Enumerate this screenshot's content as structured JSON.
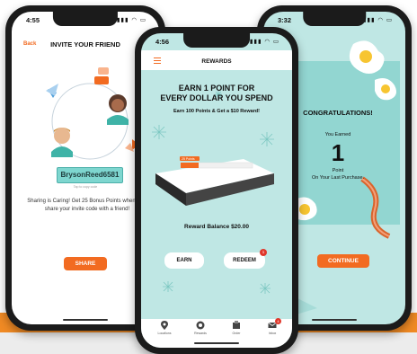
{
  "colors": {
    "accent": "#f26b21",
    "teal": "#92d6d1",
    "band": "#f08a24"
  },
  "left_screen": {
    "time": "4:55",
    "status_icons": "▮▮▮ ◠ ▭",
    "back_label": "Back",
    "title": "INVITE YOUR FRIEND",
    "invite_code": "BrysonReed6581",
    "tap_hint": "Tap to copy code",
    "share_text": "Sharing is Caring! Get 25 Bonus Points when they share your invite code with a friend!",
    "share_button": "SHARE"
  },
  "center_screen": {
    "time": "4:56",
    "status_icons": "▮▮▮ ◠ ▭",
    "menu_icon": "hamburger-icon",
    "title": "REWARDS",
    "headline_1": "EARN 1 POINT FOR",
    "headline_2": "EVERY DOLLAR YOU SPEND",
    "subline": "Earn 100 Points & Get a $10 Reward!",
    "progress_label": "25 Points",
    "progress_value": 25,
    "progress_goal": 100,
    "balance": "Reward Balance $20.00",
    "earn_button": "EARN",
    "redeem_button": "REDEEM",
    "redeem_badge": "1",
    "tabs": [
      {
        "label": "Locations",
        "icon": "location-pin-icon"
      },
      {
        "label": "Rewards",
        "icon": "rewards-icon"
      },
      {
        "label": "Order",
        "icon": "order-icon"
      },
      {
        "label": "Inbox",
        "icon": "mail-icon",
        "badge": "4"
      }
    ]
  },
  "right_screen": {
    "time": "3:32",
    "status_icons": "▮▮▮ ◠ ▭",
    "congrats": "CONGRATULATIONS!",
    "earned_label": "You Earned",
    "points": "1",
    "point_line1": "Point",
    "point_line2": "On Your Last Purchase.",
    "continue_button": "CONTINUE"
  }
}
